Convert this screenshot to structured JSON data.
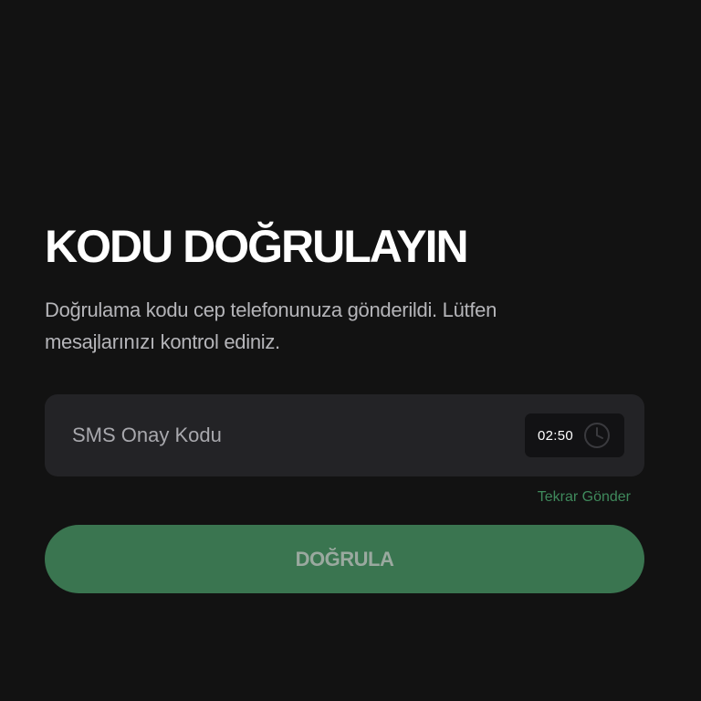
{
  "page": {
    "title": "KODU DOĞRULAYIN",
    "subtitle": "Doğrulama kodu cep telefonunuza gönderildi. Lütfen mesajlarınızı kontrol ediniz."
  },
  "code_field": {
    "placeholder": "SMS Onay Kodu",
    "value": ""
  },
  "timer": {
    "text": "02:50",
    "icon": "clock-icon"
  },
  "resend": {
    "label": "Tekrar Gönder"
  },
  "verify_button": {
    "label": "DOĞRULA"
  },
  "colors": {
    "background": "#121212",
    "field_background": "#232326",
    "accent": "#3a7550",
    "link": "#3f8a5c"
  }
}
